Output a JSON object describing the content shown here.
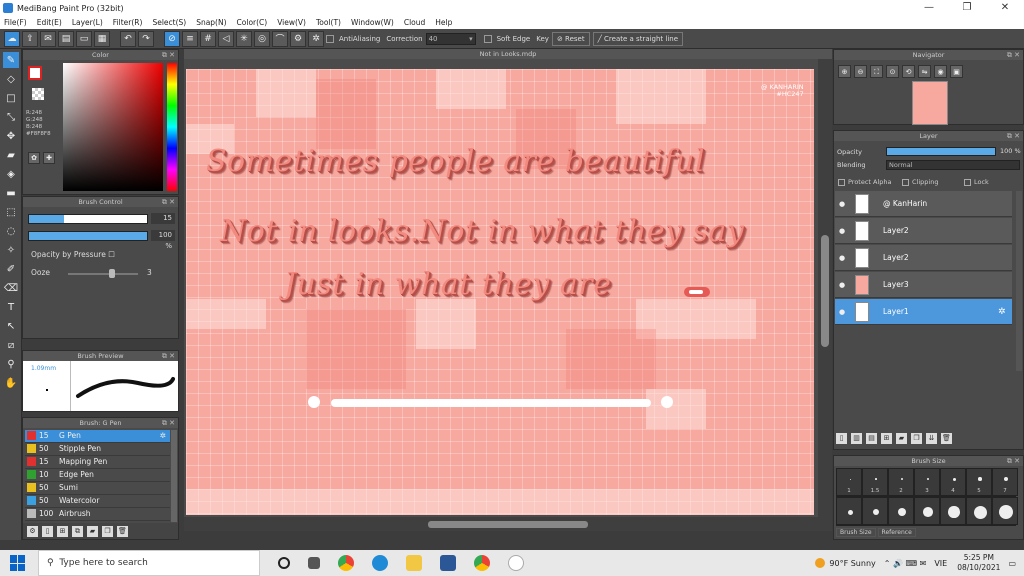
{
  "window": {
    "title": "MediBang Paint Pro (32bit)",
    "minimize": "—",
    "maximize": "❐",
    "close": "✕"
  },
  "menu": [
    "File(F)",
    "Edit(E)",
    "Layer(L)",
    "Filter(R)",
    "Select(S)",
    "Snap(N)",
    "Color(C)",
    "View(V)",
    "Tool(T)",
    "Window(W)",
    "Cloud",
    "Help"
  ],
  "toolbar": {
    "antialiasing": "AntiAliasing",
    "correction_label": "Correction",
    "correction_value": "40",
    "soft_edge": "Soft Edge",
    "key": "Key",
    "reset": "Reset",
    "straight_line": "Create a straight line"
  },
  "color_panel": {
    "title": "Color",
    "rgb": "R:248\nG:248\nB:248",
    "hex": "#F8F8F8",
    "fg_color": "#ffffff",
    "accent": "#dd2222"
  },
  "brush_control": {
    "title": "Brush Control",
    "size_value": "15",
    "opacity_value": "100 %",
    "opacity_by_pressure": "Opacity by Pressure",
    "ooze_label": "Ooze",
    "ooze_value": "3"
  },
  "brush_preview": {
    "title": "Brush Preview",
    "size": "1.09mm"
  },
  "brush_list": {
    "title": "Brush: G Pen",
    "items": [
      {
        "size": "15",
        "name": "G Pen",
        "color": "#e03030",
        "selected": true
      },
      {
        "size": "50",
        "name": "Stipple Pen",
        "color": "#e8c020"
      },
      {
        "size": "15",
        "name": "Mapping Pen",
        "color": "#e03030"
      },
      {
        "size": "10",
        "name": "Edge Pen",
        "color": "#30a030"
      },
      {
        "size": "50",
        "name": "Sumi",
        "color": "#e8c020"
      },
      {
        "size": "50",
        "name": "Watercolor",
        "color": "#3aa0e0"
      },
      {
        "size": "100",
        "name": "Airbrush",
        "color": "#bbbbbb"
      }
    ]
  },
  "canvas": {
    "tab_title": "Not in Looks.mdp",
    "signature": "@ KANHARIN\n#HC247",
    "line1": "Sometimes people are beautiful",
    "line2": "Not in looks.Not in what they say",
    "line3": "Just in what they are",
    "bg_color": "#f7a89f"
  },
  "navigator": {
    "title": "Navigator"
  },
  "layer_panel": {
    "title": "Layer",
    "opacity_label": "Opacity",
    "opacity_value": "100 %",
    "blending_label": "Blending",
    "blending_value": "Normal",
    "protect_alpha": "Protect Alpha",
    "clipping": "Clipping",
    "lock": "Lock",
    "layers": [
      {
        "name": "@ KanHarin",
        "selected": false
      },
      {
        "name": "Layer2",
        "selected": false
      },
      {
        "name": "Layer2",
        "selected": false
      },
      {
        "name": "Layer3",
        "selected": false
      },
      {
        "name": "Layer1",
        "selected": true
      }
    ]
  },
  "brush_size": {
    "title": "Brush Size",
    "sizes": [
      "1",
      "1.5",
      "2",
      "3",
      "4",
      "5",
      "7"
    ],
    "tab_brush_size": "Brush Size",
    "tab_reference": "Reference"
  },
  "taskbar": {
    "search_placeholder": "Type here to search",
    "weather": "90°F  Sunny",
    "language": "VIE",
    "time": "5:25 PM",
    "date": "08/10/2021"
  }
}
